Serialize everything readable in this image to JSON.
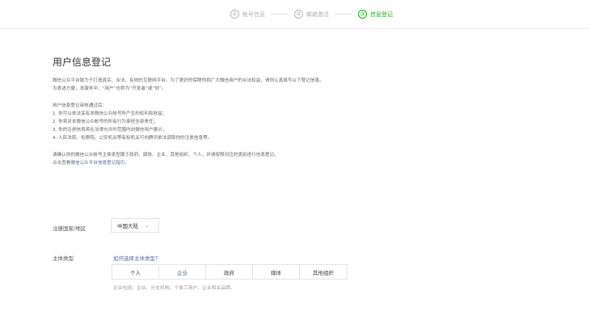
{
  "stepper": {
    "steps": [
      {
        "num": "①",
        "label": "帐号信息",
        "active": false
      },
      {
        "num": "②",
        "label": "邮箱激活",
        "active": false
      },
      {
        "num": "③",
        "label": "信息登记",
        "active": true
      }
    ],
    "active_color": "#1aad19"
  },
  "main": {
    "title": "用户信息登记",
    "intro": [
      "微信公众平台致力于打造真实、合法、有效的互联网平台。为了更好的保障你和广大微信用户的合法权益，请你认真填写以下登记信息。",
      "为表述方便，本服务中，“用户”也称为“开发者”或“你”。"
    ],
    "rights": [
      "用户信息登记审核通过后：",
      "1. 你可以依法享有本微信公众帐号所产生的权利和收益；",
      "2. 你将对本微信公众帐号的所有行为承担全部责任；",
      "3. 你的注册信息将在法律允许的范围内向微信用户展示；",
      "4. 人民法院、检察院、公安机关等有权机关可向腾讯依法调取你的注册信息等。"
    ],
    "confirm": "请确认你的微信公众帐号主体类型属于政府、媒体、企业、其他组织、个人，并请按照对应的类别进行信息登记。",
    "guide_prefix": "点击查看",
    "guide_link": "微信公众平台信息登记指引",
    "guide_suffix": "。"
  },
  "form": {
    "region_label": "注册国家/地区",
    "region_value": "中国大陆",
    "subject_label": "主体类型",
    "subject_help": "如何选择主体类型？",
    "subject_types": [
      "个人",
      "企业",
      "政府",
      "媒体",
      "其他组织"
    ],
    "subject_selected": "企业",
    "subject_note": "企业包括：企业、分支机构、个体工商户、企业相关品牌。"
  },
  "colors": {
    "link": "#576b95",
    "accent": "#1aad19"
  }
}
